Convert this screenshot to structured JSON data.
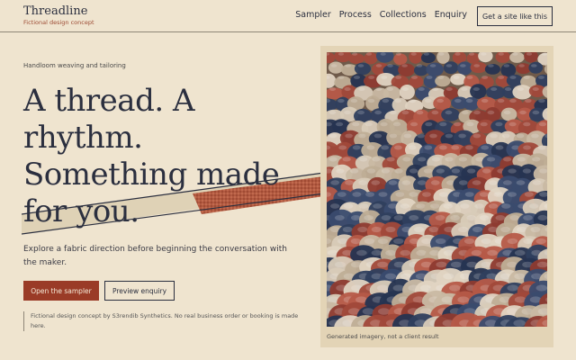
{
  "brand": {
    "name": "Threadline",
    "tagline": "Fictional design concept"
  },
  "nav": {
    "items": [
      "Sampler",
      "Process",
      "Collections",
      "Enquiry"
    ],
    "cta_label": "Get a site like this"
  },
  "hero": {
    "eyebrow": "Handloom weaving and tailoring",
    "headline_lines": [
      "A thread. A",
      "rhythm.",
      "Something made",
      "for you."
    ],
    "lede": "Explore a fabric direction before beginning the conversation with the maker.",
    "primary_label": "Open the sampler",
    "secondary_label": "Preview enquiry",
    "disclaimer": "Fictional design concept by S3rendib Synthetics. No real business order or booking is made here."
  },
  "photo": {
    "caption": "Generated imagery, not a client result",
    "icon": "woven-yarn-photo"
  },
  "colors": {
    "background": "#efe4cf",
    "ink": "#2b2f3f",
    "accent": "#9a3b27",
    "card": "#e3d4b6"
  }
}
